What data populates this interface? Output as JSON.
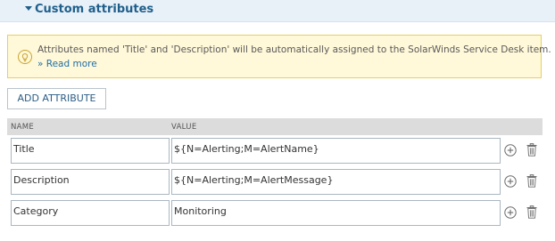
{
  "section": {
    "title": "Custom attributes",
    "caret_icon": "caret-down-icon"
  },
  "info": {
    "icon": "lightbulb-icon",
    "message": "Attributes named 'Title' and 'Description' will be automatically assigned to the SolarWinds Service Desk item.",
    "read_more": "» Read more"
  },
  "toolbar": {
    "add_attribute_label": "ADD ATTRIBUTE"
  },
  "table": {
    "columns": [
      "NAME",
      "VALUE"
    ],
    "rows": [
      {
        "name": "Title",
        "value": "${N=Alerting;M=AlertName}"
      },
      {
        "name": "Description",
        "value": "${N=Alerting;M=AlertMessage}"
      },
      {
        "name": "Category",
        "value": "Monitoring"
      }
    ],
    "row_actions": {
      "add_icon": "plus-circle-icon",
      "delete_icon": "trash-icon"
    }
  },
  "colors": {
    "header_bg": "#e8f1f8",
    "accent": "#1f5f8b",
    "info_bg": "#fff8d9",
    "info_border": "#e8cf60",
    "table_header_bg": "#dcdcdc"
  }
}
